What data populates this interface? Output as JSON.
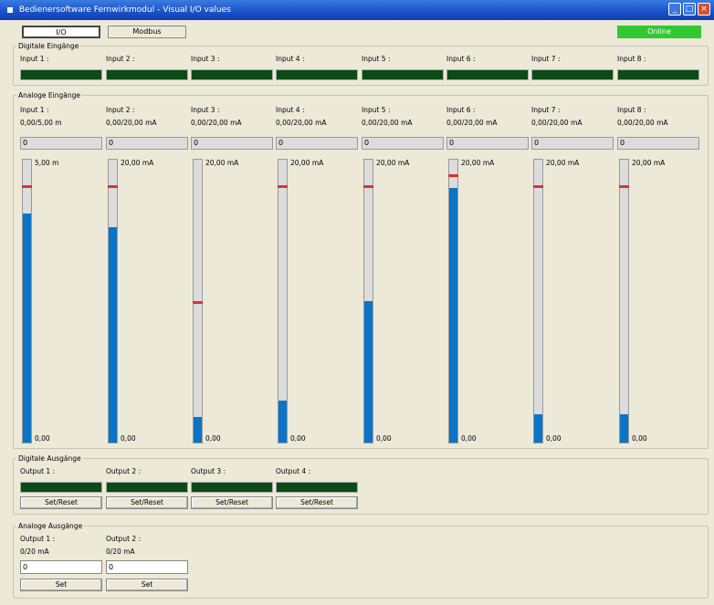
{
  "window": {
    "title": "Bedienersoftware Fernwirkmodul - Visual I/O values"
  },
  "toolbar": {
    "io_tab": "I/O",
    "modbus_tab": "Modbus",
    "status": "Online"
  },
  "digital_inputs": {
    "title": "Digitale Eingänge",
    "items": [
      "Input 1 :",
      "Input 2 :",
      "Input 3 :",
      "Input 4 :",
      "Input 5 :",
      "Input 6 :",
      "Input 7 :",
      "Input 8 :"
    ]
  },
  "analog_inputs": {
    "title": "Analoge Eingänge",
    "items": [
      {
        "label": "Input 1 :",
        "range": "0,00/5,00 m",
        "value": "0",
        "max": "5,00 m",
        "min": "0,00",
        "fill": 0.81,
        "mark": 0.9
      },
      {
        "label": "Input 2 :",
        "range": "0,00/20,00 mA",
        "value": "0",
        "max": "20,00 mA",
        "min": "0,00",
        "fill": 0.76,
        "mark": 0.9
      },
      {
        "label": "Input 3 :",
        "range": "0,00/20,00 mA",
        "value": "0",
        "max": "20,00 mA",
        "min": "0,00",
        "fill": 0.09,
        "mark": 0.49
      },
      {
        "label": "Input 4 :",
        "range": "0,00/20,00 mA",
        "value": "0",
        "max": "20,00 mA",
        "min": "0,00",
        "fill": 0.15,
        "mark": 0.9
      },
      {
        "label": "Input 5 :",
        "range": "0,00/20,00 mA",
        "value": "0",
        "max": "20,00 mA",
        "min": "0,00",
        "fill": 0.5,
        "mark": 0.9
      },
      {
        "label": "Input 6 :",
        "range": "0,00/20,00 mA",
        "value": "0",
        "max": "20,00 mA",
        "min": "0,00",
        "fill": 0.9,
        "mark": 0.94
      },
      {
        "label": "Input 7 :",
        "range": "0,00/20,00 mA",
        "value": "0",
        "max": "20,00 mA",
        "min": "0,00",
        "fill": 0.1,
        "mark": 0.9
      },
      {
        "label": "Input 8 :",
        "range": "0,00/20,00 mA",
        "value": "0",
        "max": "20,00 mA",
        "min": "0,00",
        "fill": 0.1,
        "mark": 0.9
      }
    ]
  },
  "digital_outputs": {
    "title": "Digitale Ausgänge",
    "items": [
      {
        "label": "Output 1 :",
        "button": "Set/Reset"
      },
      {
        "label": "Output 2 :",
        "button": "Set/Reset"
      },
      {
        "label": "Output 3 :",
        "button": "Set/Reset"
      },
      {
        "label": "Output 4 :",
        "button": "Set/Reset"
      }
    ]
  },
  "analog_outputs": {
    "title": "Analoge Ausgänge",
    "items": [
      {
        "label": "Output 1 :",
        "range": "0/20 mA",
        "value": "0",
        "button": "Set"
      },
      {
        "label": "Output 2 :",
        "range": "0/20 mA",
        "value": "0",
        "button": "Set"
      }
    ]
  },
  "colors": {
    "led_off": "#0c4a16",
    "bar_fill": "#0b74c6",
    "mark": "#e03030",
    "online": "#32c832"
  }
}
